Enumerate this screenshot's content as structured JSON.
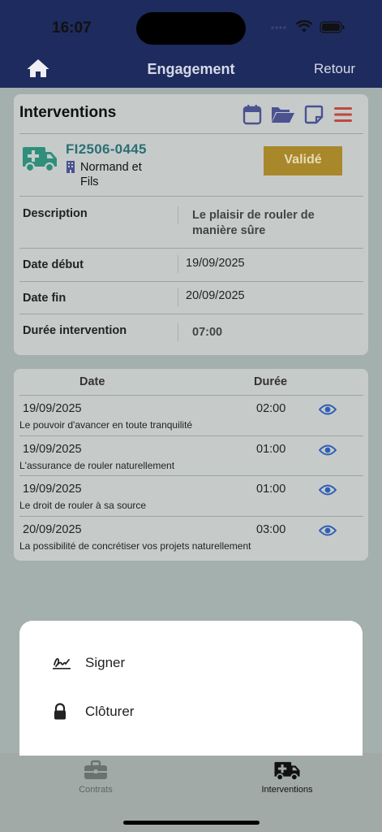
{
  "status_bar": {
    "time": "16:07"
  },
  "navbar": {
    "title": "Engagement",
    "back_label": "Retour"
  },
  "intervention_card": {
    "title": "Interventions",
    "reference": "FI2506-0445",
    "client_line1": "Normand et",
    "client_line2": "Fils",
    "status": "Validé",
    "fields": {
      "description_label": "Description",
      "description_line1": "Le plaisir de rouler de",
      "description_line2": "manière sûre",
      "start_label": "Date début",
      "start_value": "19/09/2025",
      "end_label": "Date fin",
      "end_value": "20/09/2025",
      "duration_label": "Durée intervention",
      "duration_value": "07:00"
    }
  },
  "lines_table": {
    "headers": {
      "date": "Date",
      "duration": "Durée"
    },
    "rows": [
      {
        "date": "19/09/2025",
        "duration": "02:00",
        "description": "Le pouvoir d'avancer en toute tranquilité"
      },
      {
        "date": "19/09/2025",
        "duration": "01:00",
        "description": "L'assurance de rouler naturellement"
      },
      {
        "date": "19/09/2025",
        "duration": "01:00",
        "description": "Le droit de rouler à sa source"
      },
      {
        "date": "20/09/2025",
        "duration": "03:00",
        "description": "La possibilité de concrétiser vos projets naturellement"
      }
    ]
  },
  "action_sheet": {
    "sign_label": "Signer",
    "close_label": "Clôturer"
  },
  "tabbar": {
    "contracts_label": "Contrats",
    "interventions_label": "Interventions"
  },
  "colors": {
    "navbar": "#1e2b5e",
    "accent_icon": "#4a5390",
    "status_badge": "#a8882b",
    "ref_text": "#2b6f74",
    "eye_icon": "#2f5fb5",
    "menu_icon": "#c0473f"
  },
  "icons": [
    "home-icon",
    "calendar-icon",
    "folder-open-icon",
    "note-icon",
    "menu-icon",
    "ambulance-icon",
    "building-icon",
    "eye-icon",
    "signature-icon",
    "lock-icon",
    "briefcase-icon"
  ]
}
